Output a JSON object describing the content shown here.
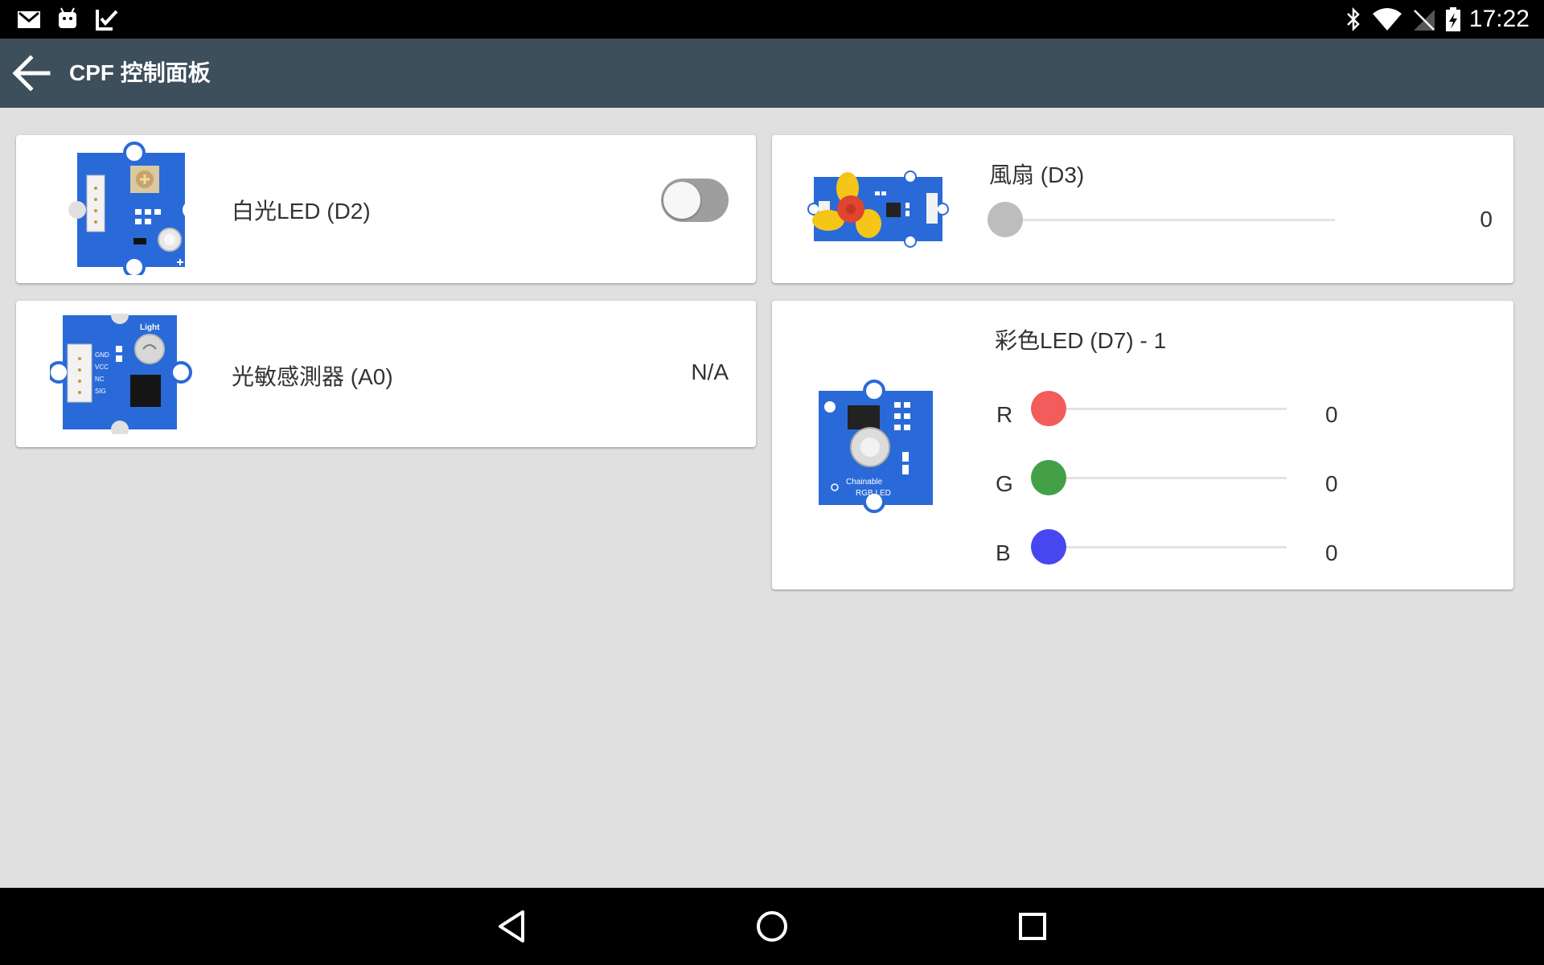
{
  "status_bar": {
    "time": "17:22",
    "left_icons": [
      "gmail-icon",
      "android-icon",
      "tasks-check-icon"
    ],
    "right_icons": [
      "bluetooth-icon",
      "wifi-icon",
      "no-signal-icon",
      "battery-charging-icon"
    ]
  },
  "app_bar": {
    "title": "CPF 控制面板",
    "back_icon": "arrow-left-icon",
    "color": "#3c4f5b"
  },
  "cards": {
    "white_led": {
      "label": "白光LED (D2)",
      "on": false
    },
    "fan": {
      "label": "風扇 (D3)",
      "value": "0",
      "level": 0
    },
    "light_sensor": {
      "label": "光敏感測器 (A0)",
      "value": "N/A"
    },
    "color_led": {
      "label": "彩色LED (D7) - 1",
      "channels": [
        {
          "name": "R",
          "value": "0",
          "level": 0,
          "color": "#f25c5c"
        },
        {
          "name": "G",
          "value": "0",
          "level": 0,
          "color": "#43a047"
        },
        {
          "name": "B",
          "value": "0",
          "level": 0,
          "color": "#4747f0"
        }
      ]
    }
  },
  "module_text": {
    "light": "Light",
    "rgb_line1": "Chainable",
    "rgb_line2": "RGB  LED"
  },
  "nav_bar": {
    "buttons": [
      "back-triangle-icon",
      "home-circle-icon",
      "recents-square-icon"
    ]
  }
}
